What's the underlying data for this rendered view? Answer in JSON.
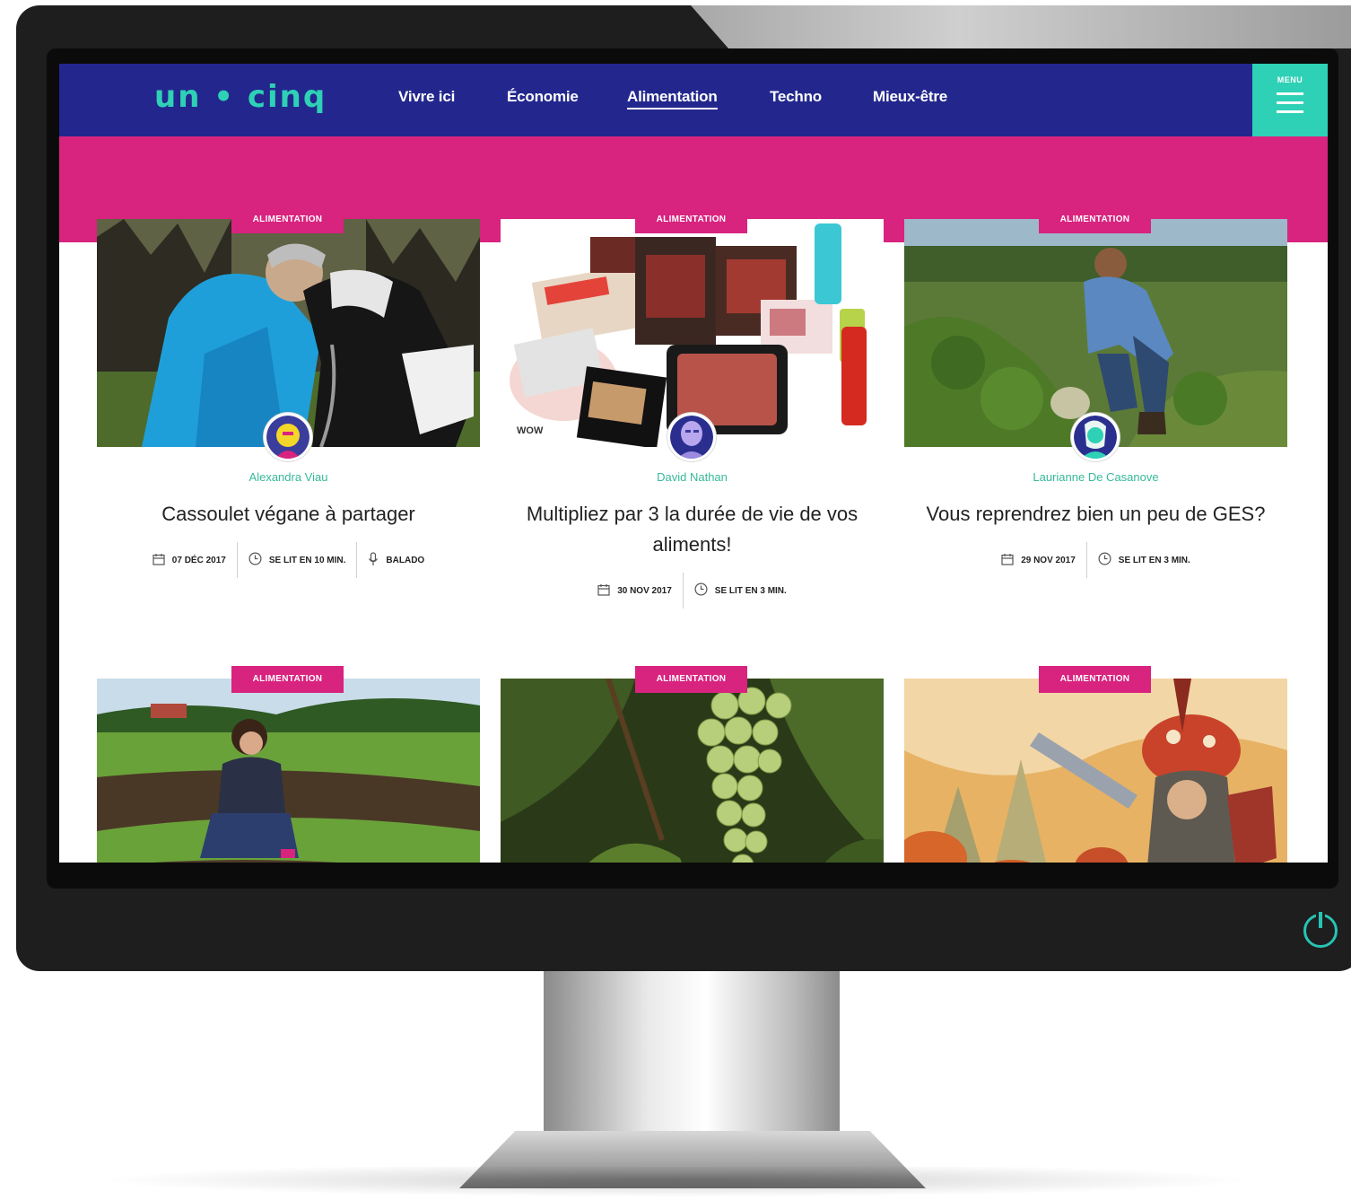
{
  "site": {
    "logo": "un • cinq",
    "menu_label": "MENU",
    "nav": [
      "Vivre ici",
      "Économie",
      "Alimentation",
      "Techno",
      "Mieux-être"
    ],
    "active_nav": "Alimentation"
  },
  "colors": {
    "nav_bg": "#23278d",
    "accent_pink": "#d8237f",
    "accent_teal": "#2ed1b6",
    "author_green": "#36b99a"
  },
  "cards": [
    {
      "category": "ALIMENTATION",
      "author": "Alexandra Viau",
      "title": "Cassoulet végane à partager",
      "meta": [
        {
          "icon": "calendar-icon",
          "text": "07 DÉC 2017"
        },
        {
          "icon": "clock-icon",
          "text": "SE LIT EN 10 MIN."
        },
        {
          "icon": "microphone-icon",
          "text": "BALADO"
        }
      ]
    },
    {
      "category": "ALIMENTATION",
      "author": "David Nathan",
      "badge": "WOW",
      "title": "Multipliez par 3 la durée de vie de vos aliments!",
      "meta": [
        {
          "icon": "calendar-icon",
          "text": "30 NOV 2017"
        },
        {
          "icon": "clock-icon",
          "text": "SE LIT EN 3 MIN."
        }
      ]
    },
    {
      "category": "ALIMENTATION",
      "author": "Laurianne De Casanove",
      "title": "Vous reprendrez bien un peu de GES?",
      "meta": [
        {
          "icon": "calendar-icon",
          "text": "29 NOV 2017"
        },
        {
          "icon": "clock-icon",
          "text": "SE LIT EN 3 MIN."
        }
      ]
    },
    {
      "category": "ALIMENTATION"
    },
    {
      "category": "ALIMENTATION"
    },
    {
      "category": "ALIMENTATION"
    }
  ]
}
